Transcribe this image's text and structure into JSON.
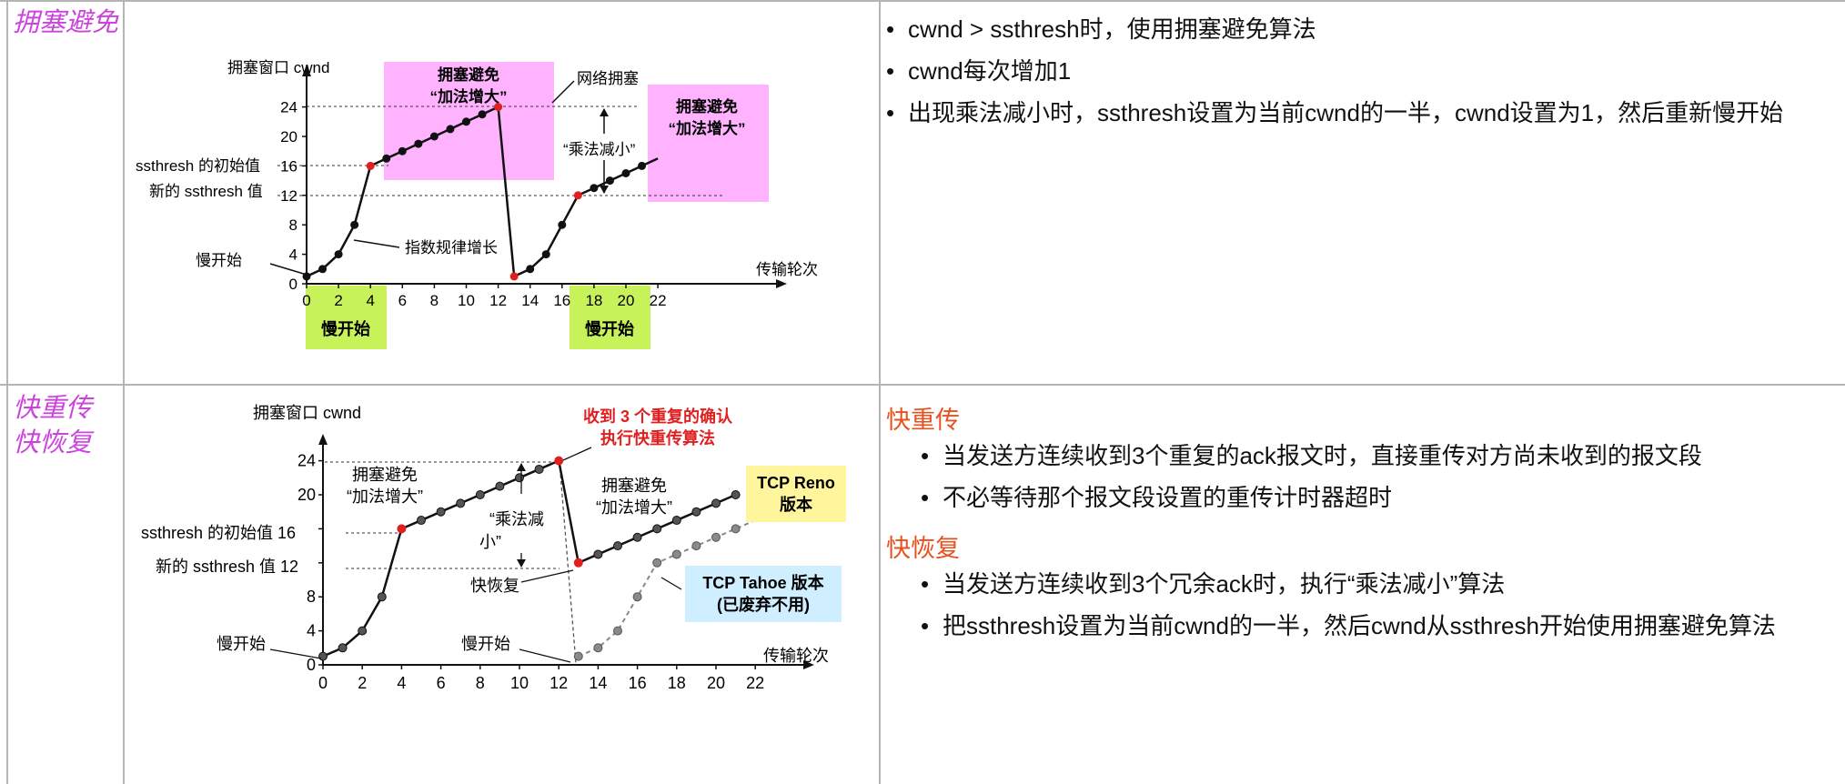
{
  "rows": [
    {
      "label": "拥塞避免",
      "points": [
        "cwnd > ssthresh时，使用拥塞避免算法",
        "cwnd每次增加1",
        "出现乘法减小时，ssthresh设置为当前cwnd的一半，cwnd设置为1，然后重新慢开始"
      ],
      "figure": {
        "y_title": "拥塞窗口 cwnd",
        "x_title": "传输轮次",
        "y_ticks": [
          "0",
          "4",
          "8",
          "12",
          "16",
          "20",
          "24"
        ],
        "x_ticks": [
          "0",
          "2",
          "4",
          "6",
          "8",
          "10",
          "12",
          "14",
          "16",
          "18",
          "20",
          "22"
        ],
        "label_ssthresh_initial": "ssthresh 的初始值",
        "label_ssthresh_new": "新的 ssthresh 值",
        "label_slow_start": "慢开始",
        "label_exponential": "指数规律增长",
        "label_network_congestion": "网络拥塞",
        "label_multiplicative_decrease": "“乘法减小”",
        "box_ca_1_line1": "拥塞避免",
        "box_ca_1_line2": "“加法增大”",
        "box_ca_2_line1": "拥塞避免",
        "box_ca_2_line2": "“加法增大”",
        "box_ss_1": "慢开始",
        "box_ss_2": "慢开始",
        "highlight_colors": {
          "congestion_avoidance": "#ffb3ff",
          "slow_start": "#c8f25a",
          "red_point": "#e02020"
        }
      },
      "chart_data": {
        "type": "line",
        "xlabel": "传输轮次",
        "ylabel": "拥塞窗口 cwnd",
        "xlim": [
          0,
          22
        ],
        "ylim": [
          0,
          24
        ],
        "x_ticks": [
          0,
          2,
          4,
          6,
          8,
          10,
          12,
          14,
          16,
          18,
          20,
          22
        ],
        "y_ticks": [
          0,
          4,
          8,
          12,
          16,
          20,
          24
        ],
        "series": [
          {
            "x": [
              0,
              1,
              2,
              3,
              4,
              5,
              6,
              7,
              8,
              9,
              10,
              11,
              12,
              13,
              14,
              15,
              16,
              17,
              18,
              19,
              20,
              21,
              22
            ],
            "y": [
              1,
              2,
              4,
              8,
              16,
              17,
              18,
              19,
              20,
              21,
              22,
              23,
              24,
              1,
              2,
              4,
              8,
              12,
              13,
              14,
              15,
              16,
              17
            ]
          }
        ],
        "red_points": [
          [
            4,
            16
          ],
          [
            12,
            24
          ],
          [
            13,
            1
          ],
          [
            17,
            12
          ]
        ],
        "reference_lines": [
          12,
          16,
          24
        ]
      }
    },
    {
      "label": "快重传\n快恢复",
      "sections": [
        {
          "title": "快重传",
          "points": [
            "当发送方连续收到3个重复的ack报文时，直接重传对方尚未收到的报文段",
            "不必等待那个报文段设置的重传计时器超时"
          ]
        },
        {
          "title": "快恢复",
          "points": [
            "当发送方连续收到3个冗余ack时，执行“乘法减小”算法",
            "把ssthresh设置为当前cwnd的一半，然后cwnd从ssthresh开始使用拥塞避免算法"
          ]
        }
      ],
      "figure": {
        "y_title": "拥塞窗口 cwnd",
        "x_title": "传输轮次",
        "y_ticks": [
          "0",
          "4",
          "8",
          "12",
          "16",
          "20",
          "24"
        ],
        "x_ticks": [
          "0",
          "2",
          "4",
          "6",
          "8",
          "10",
          "12",
          "14",
          "16",
          "18",
          "20",
          "22"
        ],
        "label_ssthresh_initial": "ssthresh 的初始值 16",
        "label_ssthresh_new": "新的 ssthresh 值 12",
        "label_slow_start_1": "慢开始",
        "label_slow_start_2": "慢开始",
        "label_fast_recovery": "快恢复",
        "label_ca_1_line1": "拥塞避免",
        "label_ca_1_line2": "“加法增大”",
        "label_ca_2_line1": "拥塞避免",
        "label_ca_2_line2": "“加法增大”",
        "label_mult_line1": "“乘法减",
        "label_mult_line2": "小”",
        "red_note_line1": "收到 3 个重复的确认",
        "red_note_line2": "执行快重传算法",
        "reno_line1": "TCP Reno",
        "reno_line2": "版本",
        "tahoe_line1": "TCP Tahoe 版本",
        "tahoe_line2": "(已废弃不用)",
        "colors": {
          "reno_box": "#fff59d",
          "tahoe_box": "#cfeeff",
          "red_note": "#e02020"
        }
      },
      "chart_data": {
        "type": "line",
        "xlabel": "传输轮次",
        "ylabel": "拥塞窗口 cwnd",
        "xlim": [
          0,
          22
        ],
        "ylim": [
          0,
          24
        ],
        "x_ticks": [
          0,
          2,
          4,
          6,
          8,
          10,
          12,
          14,
          16,
          18,
          20,
          22
        ],
        "y_ticks": [
          0,
          4,
          8,
          12,
          16,
          20,
          24
        ],
        "series": [
          {
            "name": "TCP Reno 版本",
            "x": [
              0,
              1,
              2,
              3,
              4,
              5,
              6,
              7,
              8,
              9,
              10,
              11,
              12,
              13,
              14,
              15,
              16,
              17,
              18,
              19,
              20,
              21
            ],
            "y": [
              1,
              2,
              4,
              8,
              16,
              17,
              18,
              19,
              20,
              21,
              22,
              23,
              24,
              12,
              13,
              14,
              15,
              16,
              17,
              18,
              19,
              20
            ]
          },
          {
            "name": "TCP Tahoe 版本 (已废弃不用)",
            "x": [
              12,
              13,
              14,
              15,
              16,
              17,
              18,
              19,
              20,
              21,
              22
            ],
            "y": [
              24,
              1,
              2,
              4,
              8,
              12,
              13,
              14,
              15,
              16,
              17
            ]
          }
        ],
        "red_points": [
          [
            4,
            16
          ],
          [
            12,
            24
          ],
          [
            13,
            12
          ]
        ],
        "reference_lines": [
          12,
          16,
          24
        ]
      }
    }
  ]
}
